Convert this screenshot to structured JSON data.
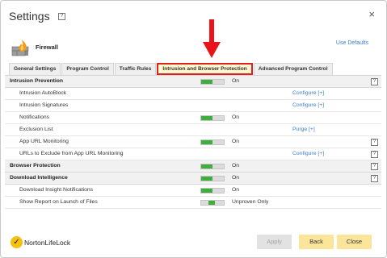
{
  "window": {
    "title": "Settings",
    "help": "?",
    "close": "×"
  },
  "firewall": {
    "label": "Firewall",
    "use_defaults": "Use Defaults"
  },
  "tabs": [
    {
      "label": "General Settings"
    },
    {
      "label": "Program Control"
    },
    {
      "label": "Traffic Rules"
    },
    {
      "label": "Intrusion and Browser Protection",
      "active": true
    },
    {
      "label": "Advanced Program Control"
    }
  ],
  "rows": [
    {
      "name": "Intrusion Prevention",
      "section": true,
      "toggle": 0.5,
      "status": "On",
      "help": "?"
    },
    {
      "name": "Intrusion AutoBlock",
      "link": "Configure [+]"
    },
    {
      "name": "Intrusion Signatures",
      "link": "Configure [+]"
    },
    {
      "name": "Notifications",
      "toggle": 0.5,
      "status": "On"
    },
    {
      "name": "Exclusion List",
      "link": "Purge [+]"
    },
    {
      "name": "App URL Monitoring",
      "toggle": 0.5,
      "status": "On",
      "help": "?"
    },
    {
      "name": "URLs to Exclude from App URL Monitoring",
      "link": "Configure [+]",
      "help": "?"
    },
    {
      "name": "Browser Protection",
      "section": true,
      "toggle": 0.5,
      "status": "On",
      "help": "?"
    },
    {
      "name": "Download Intelligence",
      "section": true,
      "toggle": 0.5,
      "status": "On",
      "help": "?"
    },
    {
      "name": "Download Insight Notifications",
      "toggle": 0.5,
      "status": "On"
    },
    {
      "name": "Show Report on Launch of Files",
      "toggle": 0.3,
      "toggle_mid": true,
      "status": "Unproven Only"
    }
  ],
  "footer": {
    "logo": "NortonLifeLock",
    "logo_mark": "✓",
    "apply": "Apply",
    "back": "Back",
    "close": "Close"
  },
  "colors": {
    "accent_green": "#3fae3f",
    "link_blue": "#3a7fd0",
    "highlight_red": "#e0201c",
    "button_yellow": "#fbe59a"
  }
}
